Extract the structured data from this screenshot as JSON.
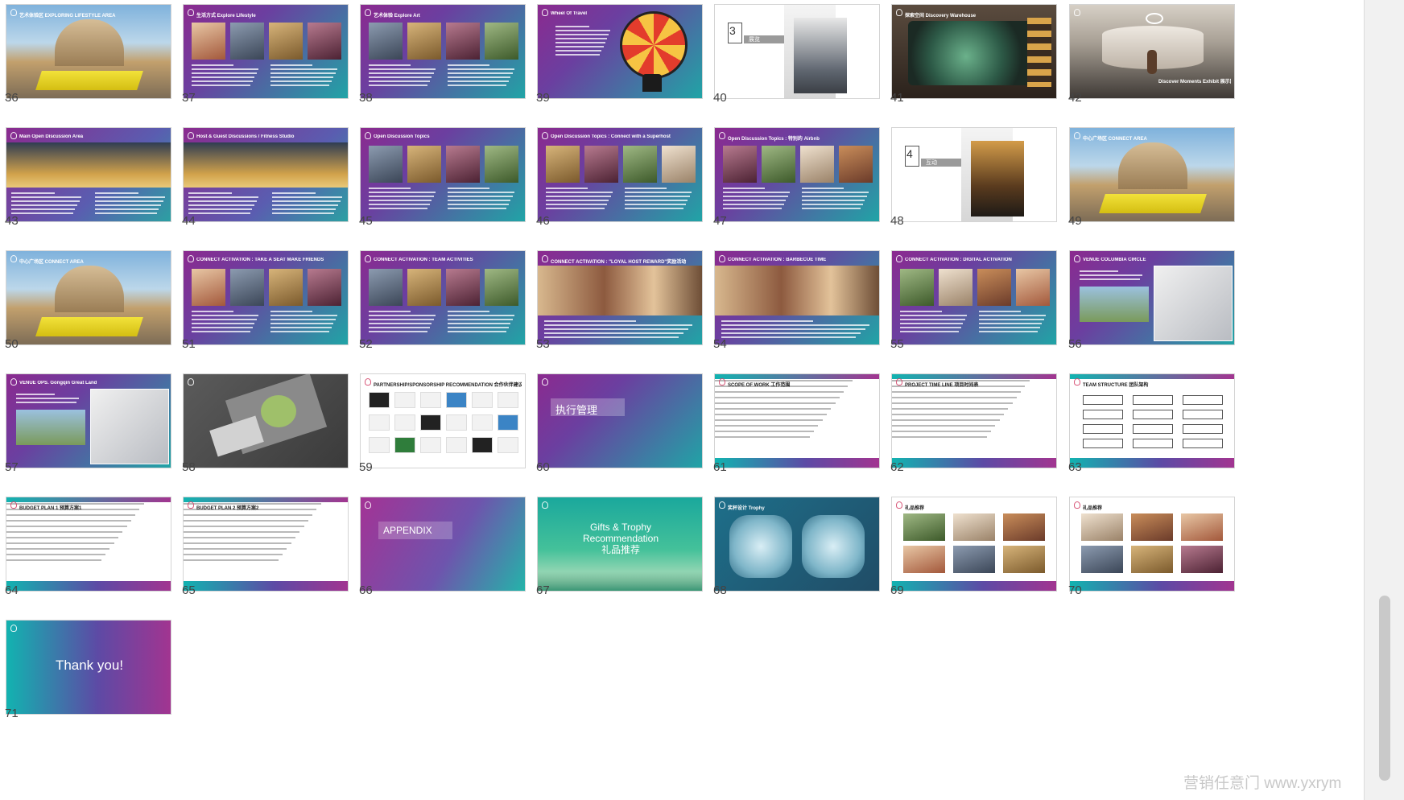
{
  "slides": [
    {
      "num": "36",
      "title": "艺术体验区 EXPLORING LIFESTYLE AREA",
      "kind": "render"
    },
    {
      "num": "37",
      "title": "生活方式 Explore Lifestyle",
      "kind": "photos"
    },
    {
      "num": "38",
      "title": "艺术体验 Explore Art",
      "kind": "photos"
    },
    {
      "num": "39",
      "title": "Wheel Of Travel",
      "kind": "wheel"
    },
    {
      "num": "40",
      "title": "",
      "kind": "section",
      "section_num": "3",
      "section_label": "展览"
    },
    {
      "num": "41",
      "title": "探索空间 Discovery Warehouse",
      "kind": "dark"
    },
    {
      "num": "42",
      "title": "Discover Moments Exhibit 展示区",
      "kind": "gallery"
    },
    {
      "num": "43",
      "title": "Main Open Discussion Area",
      "kind": "render"
    },
    {
      "num": "44",
      "title": "Host & Guest Discussions / Fitness Studio",
      "kind": "render"
    },
    {
      "num": "45",
      "title": "Open Discussion Topics",
      "kind": "photos"
    },
    {
      "num": "46",
      "title": "Open Discussion Topics : Connect with a Superhost",
      "kind": "photos"
    },
    {
      "num": "47",
      "title": "Open Discussion Topics : 特别的 Airbnb",
      "kind": "photos"
    },
    {
      "num": "48",
      "title": "",
      "kind": "section",
      "section_num": "4",
      "section_label": "互动"
    },
    {
      "num": "49",
      "title": "中心广场区 CONNECT AREA",
      "kind": "render"
    },
    {
      "num": "50",
      "title": "中心广场区 CONNECT AREA",
      "kind": "render"
    },
    {
      "num": "51",
      "title": "CONNECT ACTIVATION : TAKE A SEAT MAKE FRIENDS",
      "kind": "photos"
    },
    {
      "num": "52",
      "title": "CONNECT ACTIVATION : TEAM ACTIVITIES",
      "kind": "photos"
    },
    {
      "num": "53",
      "title": "CONNECT ACTIVATION : \"LOYAL HOST REWARD\"奖励活动",
      "kind": "banner"
    },
    {
      "num": "54",
      "title": "CONNECT ACTIVATION : BARBECUE TIME",
      "kind": "banner"
    },
    {
      "num": "55",
      "title": "CONNECT ACTIVATION : DIGITAL ACTIVATION",
      "kind": "photos"
    },
    {
      "num": "56",
      "title": "VENUE COLUMBIA CIRCLE",
      "kind": "map"
    },
    {
      "num": "57",
      "title": "VENUE OPS. Gongqin Great Land",
      "kind": "map"
    },
    {
      "num": "58",
      "title": "",
      "kind": "aerial"
    },
    {
      "num": "59",
      "title": "PARTNERSHIP/SPONSORSHIP RECOMMENDATION 合作伙伴建议",
      "kind": "logos"
    },
    {
      "num": "60",
      "title": "",
      "kind": "exec",
      "heading": "执行管理"
    },
    {
      "num": "61",
      "title": "SCOPE OF WORK 工作范围",
      "kind": "doc"
    },
    {
      "num": "62",
      "title": "PROJECT TIME LINE 项目时间表",
      "kind": "doc"
    },
    {
      "num": "63",
      "title": "TEAM STRUCTURE 团队架构",
      "kind": "orgchart"
    },
    {
      "num": "64",
      "title": "BUDGET PLAN 1 预算方案1",
      "kind": "doc"
    },
    {
      "num": "65",
      "title": "BUDGET PLAN 2 预算方案2",
      "kind": "doc"
    },
    {
      "num": "66",
      "title": "",
      "kind": "appendix",
      "heading": "APPENDIX"
    },
    {
      "num": "67",
      "title": "",
      "kind": "gifts",
      "heading_lines": [
        "Gifts & Trophy",
        "Recommendation",
        "礼品推荐"
      ]
    },
    {
      "num": "68",
      "title": "奖杯设计 Trophy",
      "kind": "trophy"
    },
    {
      "num": "69",
      "title": "礼品推荐",
      "kind": "products"
    },
    {
      "num": "70",
      "title": "礼品推荐",
      "kind": "products"
    },
    {
      "num": "71",
      "title": "",
      "kind": "thanks",
      "heading": "Thank you!"
    }
  ],
  "watermark": "营销任意门 www.yxrym",
  "colors": {
    "purple": "#8b2a8f",
    "teal": "#1fa6a6",
    "pink": "#a33395"
  }
}
